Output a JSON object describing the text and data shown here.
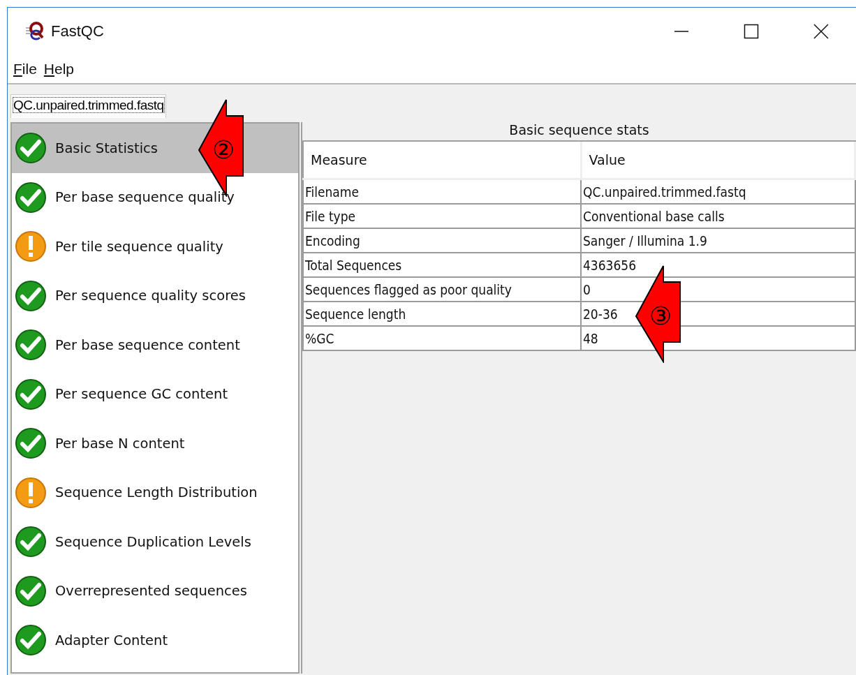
{
  "window": {
    "title": "FastQC"
  },
  "menu": [
    {
      "label": "File"
    },
    {
      "label": "Help"
    }
  ],
  "tabs": [
    {
      "label": "QC.unpaired.trimmed.fastq",
      "selected": true
    }
  ],
  "modules": [
    {
      "label": "Basic Statistics",
      "kind": "pass",
      "selected": true
    },
    {
      "label": "Per base sequence quality",
      "kind": "pass",
      "selected": false
    },
    {
      "label": "Per tile sequence quality",
      "kind": "warn",
      "selected": false
    },
    {
      "label": "Per sequence quality scores",
      "kind": "pass",
      "selected": false
    },
    {
      "label": "Per base sequence content",
      "kind": "pass",
      "selected": false
    },
    {
      "label": "Per sequence GC content",
      "kind": "pass",
      "selected": false
    },
    {
      "label": "Per base N content",
      "kind": "pass",
      "selected": false
    },
    {
      "label": "Sequence Length Distribution",
      "kind": "warn",
      "selected": false
    },
    {
      "label": "Sequence Duplication Levels",
      "kind": "pass",
      "selected": false
    },
    {
      "label": "Overrepresented sequences",
      "kind": "pass",
      "selected": false
    },
    {
      "label": "Adapter Content",
      "kind": "pass",
      "selected": false
    }
  ],
  "table": {
    "title": "Basic sequence stats",
    "columns": [
      "Measure",
      "Value"
    ],
    "rows": [
      [
        "Filename",
        "QC.unpaired.trimmed.fastq"
      ],
      [
        "File type",
        "Conventional base calls"
      ],
      [
        "Encoding",
        "Sanger / Illumina 1.9"
      ],
      [
        "Total Sequences",
        "4363656"
      ],
      [
        "Sequences flagged as poor quality",
        "0"
      ],
      [
        "Sequence length",
        "20-36"
      ],
      [
        "%GC",
        "48"
      ]
    ]
  },
  "annotations": [
    {
      "label": "②"
    },
    {
      "label": "③"
    }
  ]
}
